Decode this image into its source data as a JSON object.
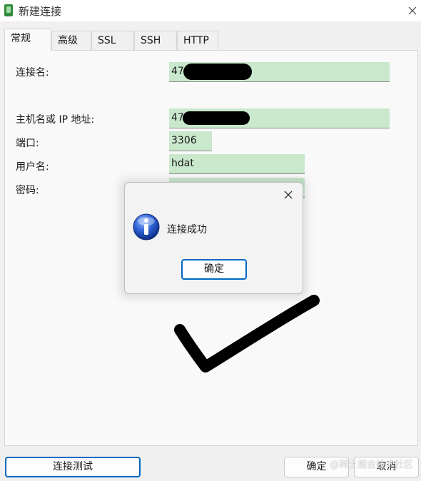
{
  "window": {
    "title": "新建连接"
  },
  "tabs": [
    {
      "label": "常规",
      "active": true
    },
    {
      "label": "高级"
    },
    {
      "label": "SSL"
    },
    {
      "label": "SSH"
    },
    {
      "label": "HTTP"
    }
  ],
  "form": {
    "connection_name": {
      "label": "连接名:",
      "value": "47"
    },
    "host": {
      "label": "主机名或 IP 地址:",
      "value": "47"
    },
    "port": {
      "label": "端口:",
      "value": "3306"
    },
    "username": {
      "label": "用户名:",
      "value": "hdat"
    },
    "password": {
      "label": "密码:",
      "value": ""
    }
  },
  "buttons": {
    "test_connection": "连接测试",
    "ok": "确定",
    "cancel": "取消"
  },
  "message_box": {
    "text": "连接成功",
    "ok_label": "确定",
    "icon": "info-icon"
  },
  "watermark": "@稀土掘金技术社区",
  "colors": {
    "field_bg": "#c9e8cc",
    "accent": "#0067c0",
    "info_blue": "#1f4fb0"
  }
}
